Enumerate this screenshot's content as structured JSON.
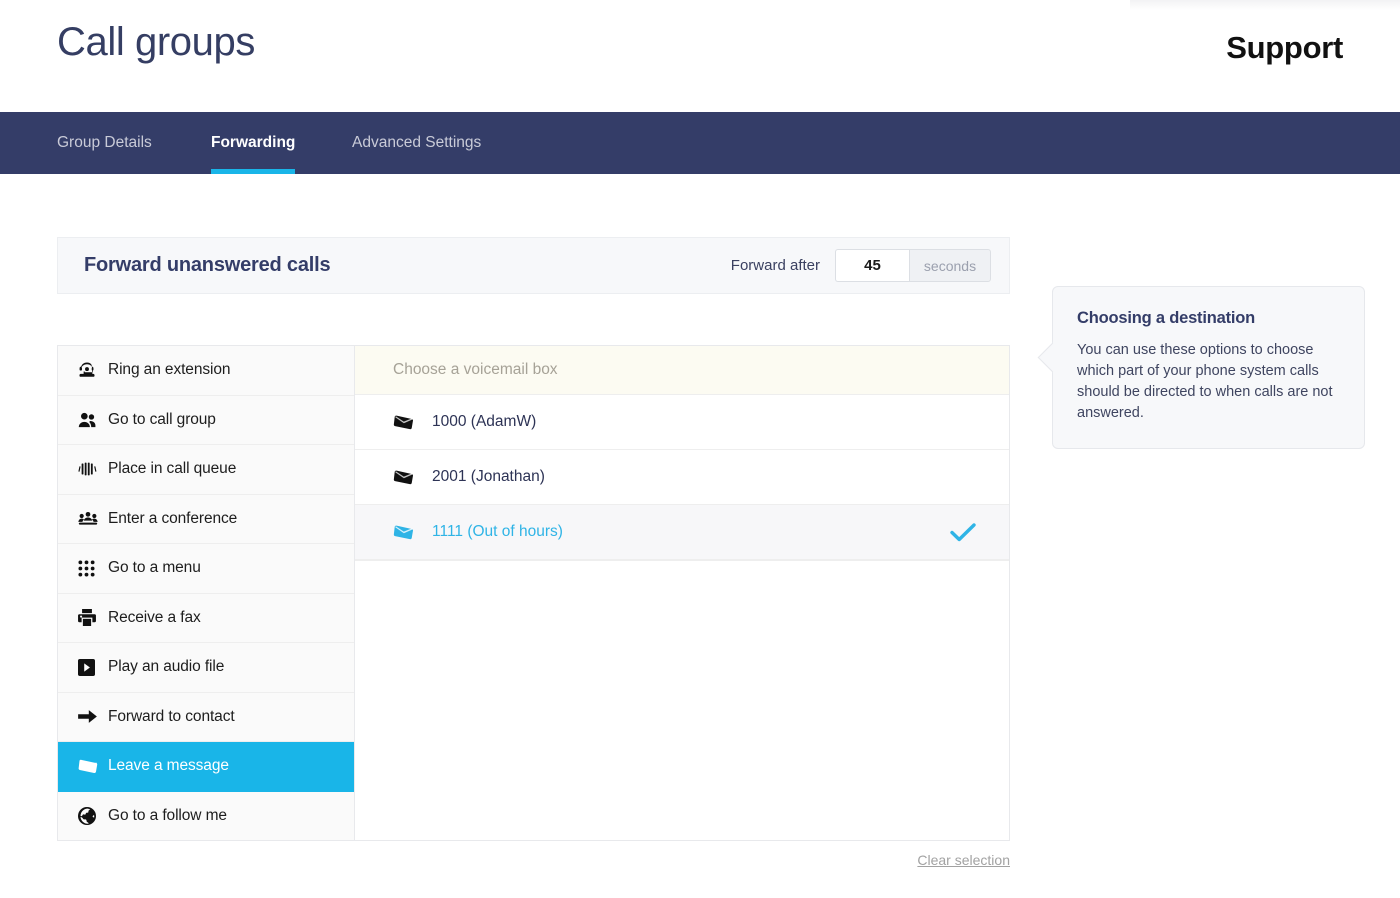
{
  "header": {
    "page_title": "Call groups",
    "group_name": "Support"
  },
  "nav": {
    "tabs": [
      {
        "label": "Group Details",
        "active": false
      },
      {
        "label": "Forwarding",
        "active": true
      },
      {
        "label": "Advanced Settings",
        "active": false
      }
    ]
  },
  "forward_panel": {
    "title": "Forward unanswered calls",
    "forward_after_label": "Forward after",
    "seconds_value": "45",
    "seconds_placeholder": "45",
    "seconds_unit": "seconds"
  },
  "destinations": [
    {
      "label": "Ring an extension",
      "icon": "telephone-icon",
      "selected": false
    },
    {
      "label": "Go to call group",
      "icon": "users-icon",
      "selected": false
    },
    {
      "label": "Place in call queue",
      "icon": "queue-icon",
      "selected": false
    },
    {
      "label": "Enter a conference",
      "icon": "conference-icon",
      "selected": false
    },
    {
      "label": "Go to a menu",
      "icon": "keypad-icon",
      "selected": false
    },
    {
      "label": "Receive a fax",
      "icon": "fax-icon",
      "selected": false
    },
    {
      "label": "Play an audio file",
      "icon": "play-icon",
      "selected": false
    },
    {
      "label": "Forward to contact",
      "icon": "arrow-right-icon",
      "selected": false
    },
    {
      "label": "Leave a message",
      "icon": "envelope-icon",
      "selected": true
    },
    {
      "label": "Go to a follow me",
      "icon": "globe-icon",
      "selected": false
    }
  ],
  "voicemail": {
    "header": "Choose a voicemail box",
    "boxes": [
      {
        "label": "1000 (AdamW)",
        "icon": "envelope-icon",
        "selected": false
      },
      {
        "label": "2001 (Jonathan)",
        "icon": "envelope-icon",
        "selected": false
      },
      {
        "label": "1111 (Out of hours)",
        "icon": "envelope-icon",
        "selected": true
      }
    ]
  },
  "clear_selection_label": "Clear selection",
  "help": {
    "title": "Choosing a destination",
    "body": "You can use these options to choose which part of your phone system calls should be directed to when calls are not answered."
  },
  "colors": {
    "navy": "#343d68",
    "accent_cyan": "#19b5e8",
    "panel_bg": "#f7f8fa",
    "vm_header_bg": "#fcfbf2"
  }
}
